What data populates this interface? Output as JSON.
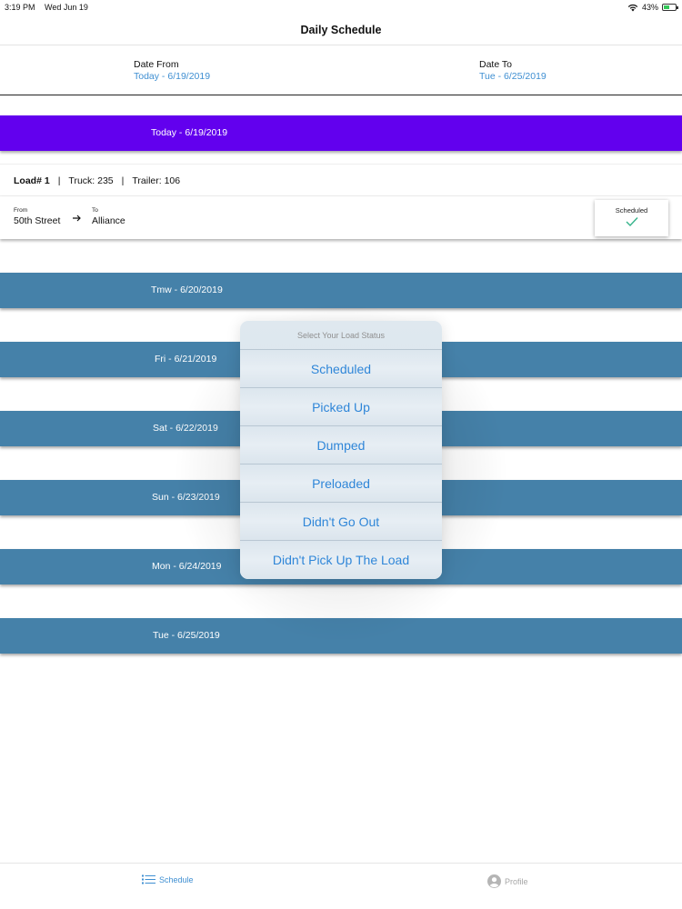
{
  "status_bar": {
    "time": "3:19 PM",
    "date": "Wed Jun 19",
    "battery": "43%"
  },
  "nav": {
    "title": "Daily Schedule"
  },
  "date_range": {
    "from_label": "Date From",
    "from_value": "Today - 6/19/2019",
    "to_label": "Date To",
    "to_value": "Tue - 6/25/2019"
  },
  "days": [
    {
      "label": "Today - 6/19/2019"
    },
    {
      "label": "Tmw - 6/20/2019"
    },
    {
      "label": "Fri - 6/21/2019"
    },
    {
      "label": "Sat - 6/22/2019"
    },
    {
      "label": "Sun - 6/23/2019"
    },
    {
      "label": "Mon - 6/24/2019"
    },
    {
      "label": "Tue - 6/25/2019"
    }
  ],
  "load": {
    "number": "Load# 1",
    "sep": "|",
    "truck": "Truck: 235",
    "trailer": "Trailer: 106",
    "from_label": "From",
    "from_place": "50th Street",
    "to_label": "To",
    "to_place": "Alliance",
    "status": "Scheduled"
  },
  "action_sheet": {
    "title": "Select Your Load Status",
    "options": [
      "Scheduled",
      "Picked Up",
      "Dumped",
      "Preloaded",
      "Didn't Go Out",
      "Didn't Pick Up The Load"
    ]
  },
  "tab_bar": {
    "schedule": "Schedule",
    "profile": "Profile"
  },
  "colors": {
    "accent": "#3f8fd2",
    "day_header": "#4581a9",
    "active_day": "#6200ee",
    "check": "#34b38a"
  }
}
